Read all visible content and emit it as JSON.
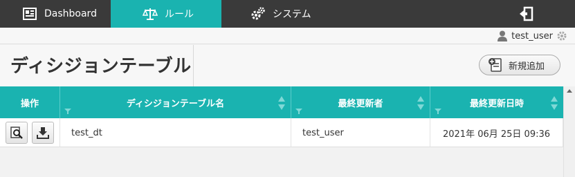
{
  "nav": {
    "dashboard": "Dashboard",
    "rule": "ルール",
    "system": "システム"
  },
  "user": {
    "name": "test_user"
  },
  "page": {
    "title": "ディシジョンテーブル",
    "add_label": "新規追加"
  },
  "table": {
    "headers": [
      "操作",
      "ディシジョンテーブル名",
      "最終更新者",
      "最終更新日時"
    ],
    "rows": [
      {
        "name": "test_dt",
        "updated_by": "test_user",
        "updated_at": "2021年 06月 25日 09:36"
      }
    ]
  },
  "colors": {
    "accent": "#1ab3b0",
    "nav_bg": "#3a3a3a"
  }
}
